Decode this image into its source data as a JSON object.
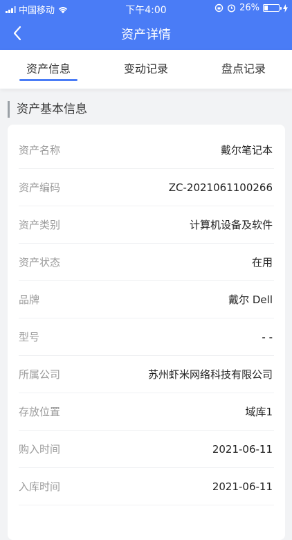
{
  "status_bar": {
    "carrier": "中国移动",
    "time": "下午4:00",
    "battery_percent": "26%",
    "battery_level": 0.26
  },
  "nav": {
    "title": "资产详情"
  },
  "tabs": [
    {
      "label": "资产信息",
      "active": true
    },
    {
      "label": "变动记录",
      "active": false
    },
    {
      "label": "盘点记录",
      "active": false
    }
  ],
  "section": {
    "title": "资产基本信息"
  },
  "fields": [
    {
      "label": "资产名称",
      "value": "戴尔笔记本"
    },
    {
      "label": "资产编码",
      "value": "ZC-2021061100266"
    },
    {
      "label": "资产类别",
      "value": "计算机设备及软件"
    },
    {
      "label": "资产状态",
      "value": "在用"
    },
    {
      "label": "品牌",
      "value": "戴尔 Dell"
    },
    {
      "label": "型号",
      "value": "- -"
    },
    {
      "label": "所属公司",
      "value": "苏州虾米网络科技有限公司"
    },
    {
      "label": "存放位置",
      "value": "域库1"
    },
    {
      "label": "购入时间",
      "value": "2021-06-11"
    },
    {
      "label": "入库时间",
      "value": "2021-06-11"
    }
  ],
  "colors": {
    "primary": "#4a7cf6",
    "background": "#f2f3f5",
    "label": "#9a9a9a",
    "value": "#222222"
  },
  "icons": [
    "signal-icon",
    "wifi-icon",
    "alarm-icon",
    "lock-rotation-icon",
    "battery-icon",
    "charging-icon",
    "back-arrow-icon"
  ]
}
